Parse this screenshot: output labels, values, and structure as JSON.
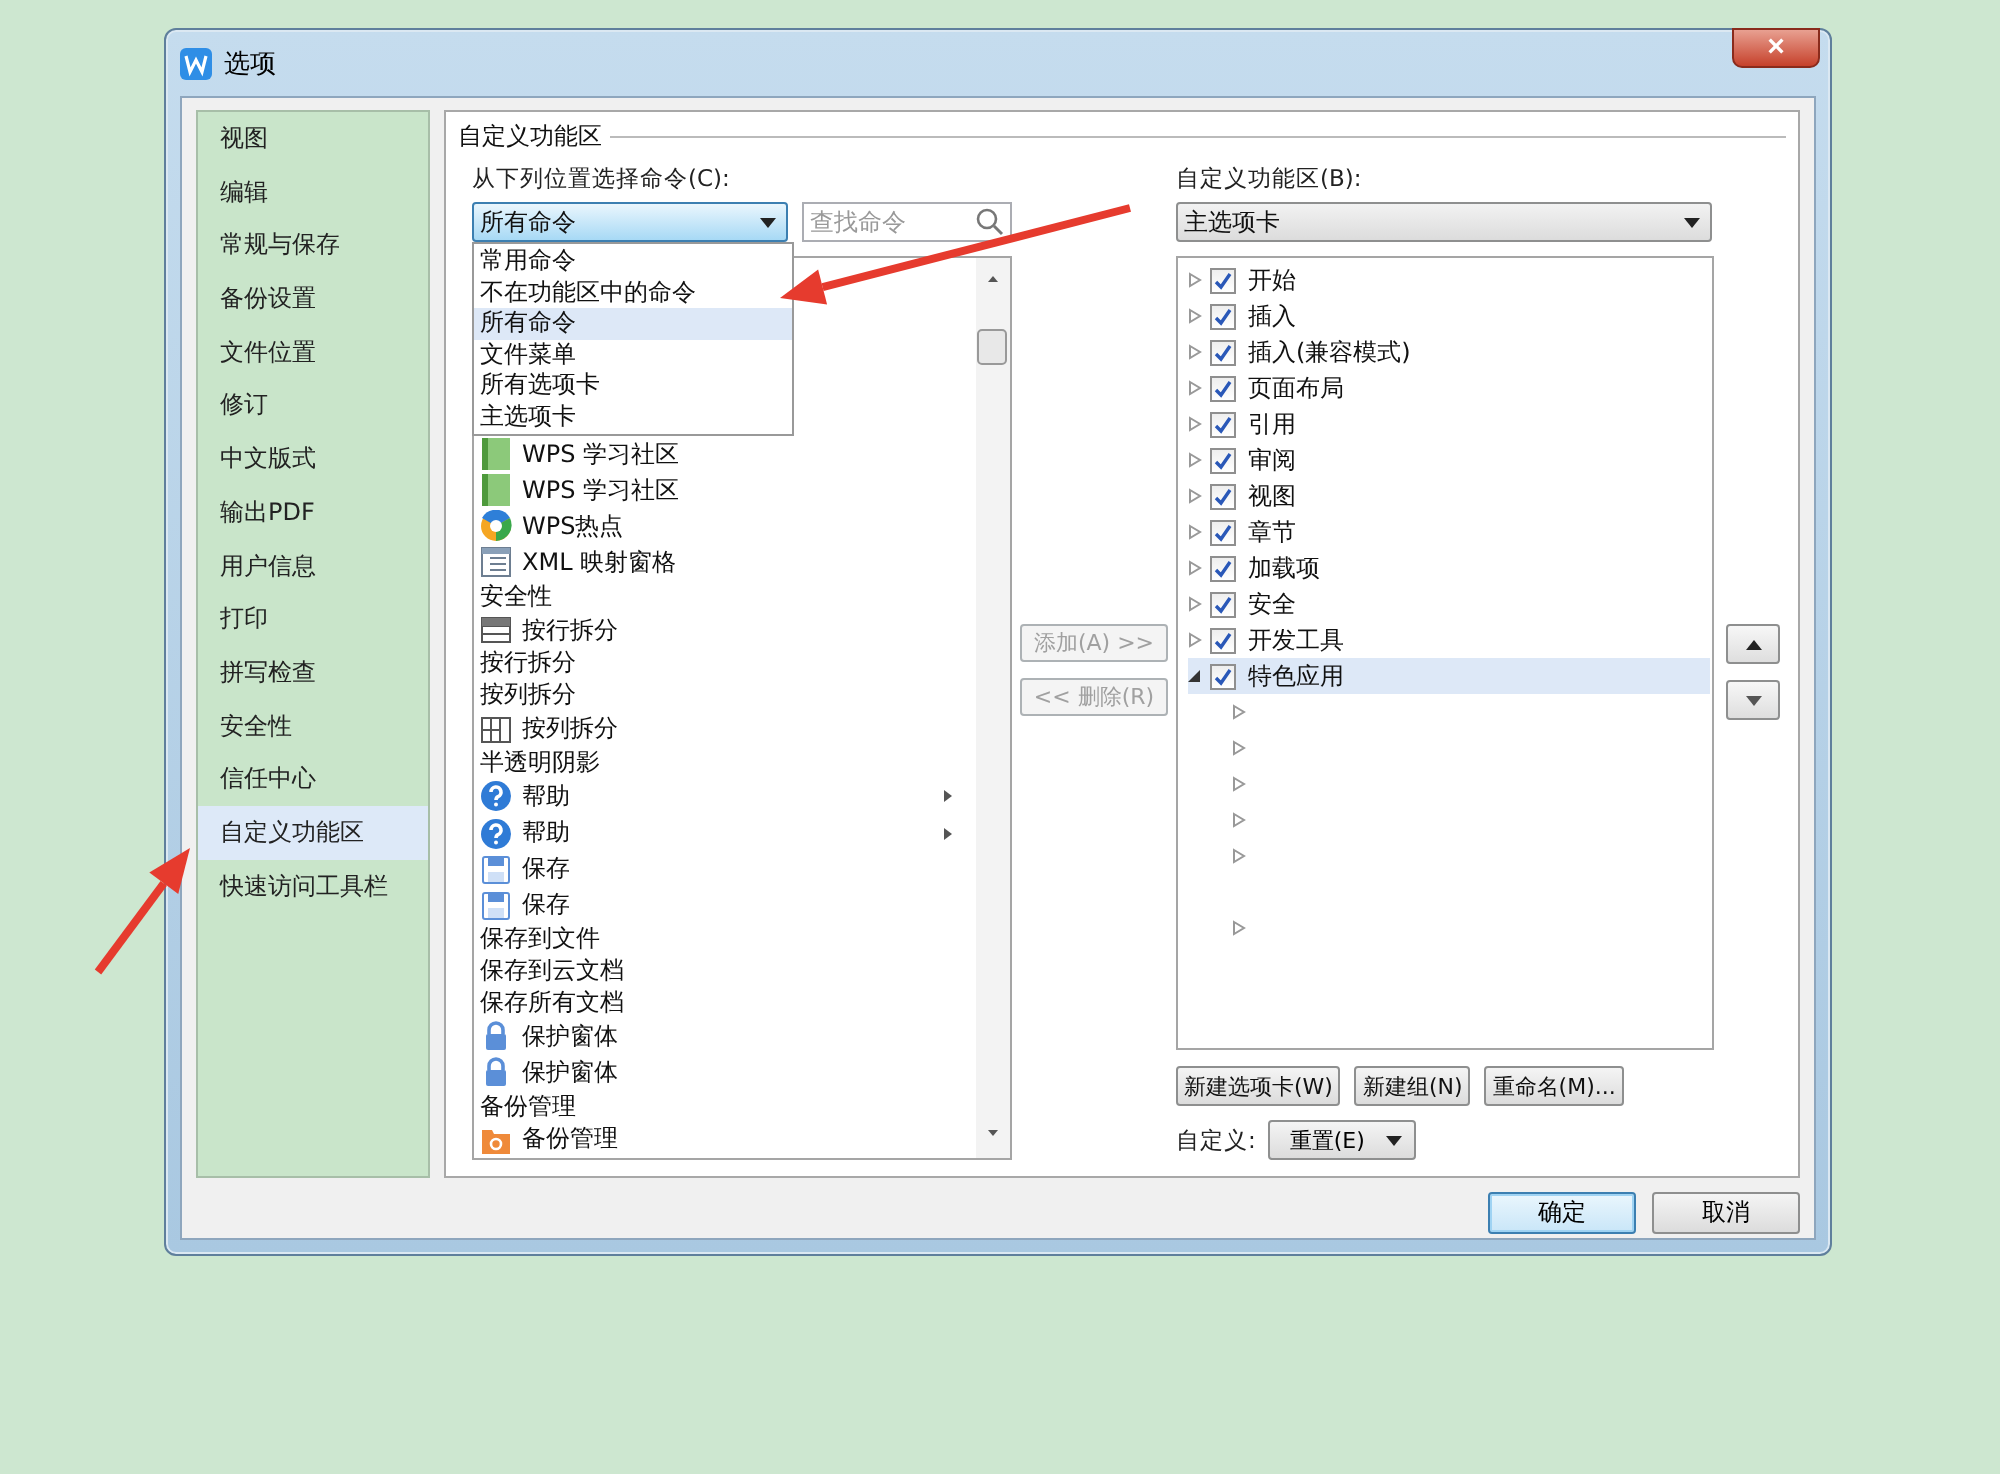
{
  "window": {
    "title": "选项",
    "close": "×"
  },
  "sidebar": {
    "items": [
      {
        "label": "视图",
        "selected": false
      },
      {
        "label": "编辑",
        "selected": false
      },
      {
        "label": "常规与保存",
        "selected": false
      },
      {
        "label": "备份设置",
        "selected": false
      },
      {
        "label": "文件位置",
        "selected": false
      },
      {
        "label": "修订",
        "selected": false
      },
      {
        "label": "中文版式",
        "selected": false
      },
      {
        "label": "输出PDF",
        "selected": false
      },
      {
        "label": "用户信息",
        "selected": false
      },
      {
        "label": "打印",
        "selected": false
      },
      {
        "label": "拼写检查",
        "selected": false
      },
      {
        "label": "安全性",
        "selected": false
      },
      {
        "label": "信任中心",
        "selected": false
      },
      {
        "label": "自定义功能区",
        "selected": true
      },
      {
        "label": "快速访问工具栏",
        "selected": false
      }
    ]
  },
  "group_title": "自定义功能区",
  "commands": {
    "label": "从下列位置选择命令(C):",
    "select_value": "所有命令",
    "search": {
      "placeholder": "查找命令"
    },
    "dropdown_options": [
      {
        "label": "常用命令",
        "selected": false
      },
      {
        "label": "不在功能区中的命令",
        "selected": false
      },
      {
        "label": "所有命令",
        "selected": true
      },
      {
        "label": "文件菜单",
        "selected": false
      },
      {
        "label": "所有选项卡",
        "selected": false
      },
      {
        "label": "主选项卡",
        "selected": false
      }
    ],
    "items": [
      {
        "label": "WPS 学习社区",
        "kind": "book",
        "submenu": false
      },
      {
        "label": "WPS 学习社区",
        "kind": "book",
        "submenu": false
      },
      {
        "label": "WPS热点",
        "kind": "hot",
        "submenu": false
      },
      {
        "label": "XML 映射窗格",
        "kind": "pane",
        "submenu": false
      },
      {
        "label": "安全性",
        "kind": "plain",
        "submenu": false
      },
      {
        "label": "按行拆分",
        "kind": "rows",
        "submenu": false
      },
      {
        "label": "按行拆分",
        "kind": "plain",
        "submenu": false
      },
      {
        "label": "按列拆分",
        "kind": "plain",
        "submenu": false
      },
      {
        "label": "按列拆分",
        "kind": "cols",
        "submenu": false
      },
      {
        "label": "半透明阴影",
        "kind": "plain",
        "submenu": false
      },
      {
        "label": "帮助",
        "kind": "help",
        "submenu": true
      },
      {
        "label": "帮助",
        "kind": "help",
        "submenu": true
      },
      {
        "label": "保存",
        "kind": "save",
        "submenu": false
      },
      {
        "label": "保存",
        "kind": "save",
        "submenu": false
      },
      {
        "label": "保存到文件",
        "kind": "plain",
        "submenu": false
      },
      {
        "label": "保存到云文档",
        "kind": "plain",
        "submenu": false
      },
      {
        "label": "保存所有文档",
        "kind": "plain",
        "submenu": false
      },
      {
        "label": "保护窗体",
        "kind": "lock",
        "submenu": false
      },
      {
        "label": "保护窗体",
        "kind": "lock",
        "submenu": false
      },
      {
        "label": "备份管理",
        "kind": "plain",
        "submenu": false
      },
      {
        "label": "备份管理",
        "kind": "folder",
        "submenu": false
      }
    ]
  },
  "move_buttons": [
    {
      "label": "添加(A) >>",
      "disabled": true
    },
    {
      "label": "<< 删除(R)",
      "disabled": true
    }
  ],
  "ribbon": {
    "label": "自定义功能区(B):",
    "select_value": "主选项卡",
    "tabs": [
      {
        "label": "开始",
        "checked": true,
        "expanded": false
      },
      {
        "label": "插入",
        "checked": true,
        "expanded": false
      },
      {
        "label": "插入(兼容模式)",
        "checked": true,
        "expanded": false
      },
      {
        "label": "页面布局",
        "checked": true,
        "expanded": false
      },
      {
        "label": "引用",
        "checked": true,
        "expanded": false
      },
      {
        "label": "审阅",
        "checked": true,
        "expanded": false
      },
      {
        "label": "视图",
        "checked": true,
        "expanded": false
      },
      {
        "label": "章节",
        "checked": true,
        "expanded": false
      },
      {
        "label": "加载项",
        "checked": true,
        "expanded": false
      },
      {
        "label": "安全",
        "checked": true,
        "expanded": false
      },
      {
        "label": "开发工具",
        "checked": true,
        "expanded": false
      },
      {
        "label": "特色应用",
        "checked": true,
        "expanded": true,
        "selected": true,
        "children": [
          {
            "kind": "group"
          },
          {
            "kind": "group"
          },
          {
            "kind": "group"
          },
          {
            "kind": "group"
          },
          {
            "kind": "group"
          },
          {
            "kind": "blank"
          },
          {
            "kind": "group"
          }
        ]
      }
    ],
    "buttons": [
      "新建选项卡(W)",
      "新建组(N)",
      "重命名(M)..."
    ],
    "reset_label": "自定义:",
    "reset_button": "重置(E)"
  },
  "footer_buttons": [
    {
      "label": "确定",
      "default": true
    },
    {
      "label": "取消",
      "default": false
    }
  ]
}
